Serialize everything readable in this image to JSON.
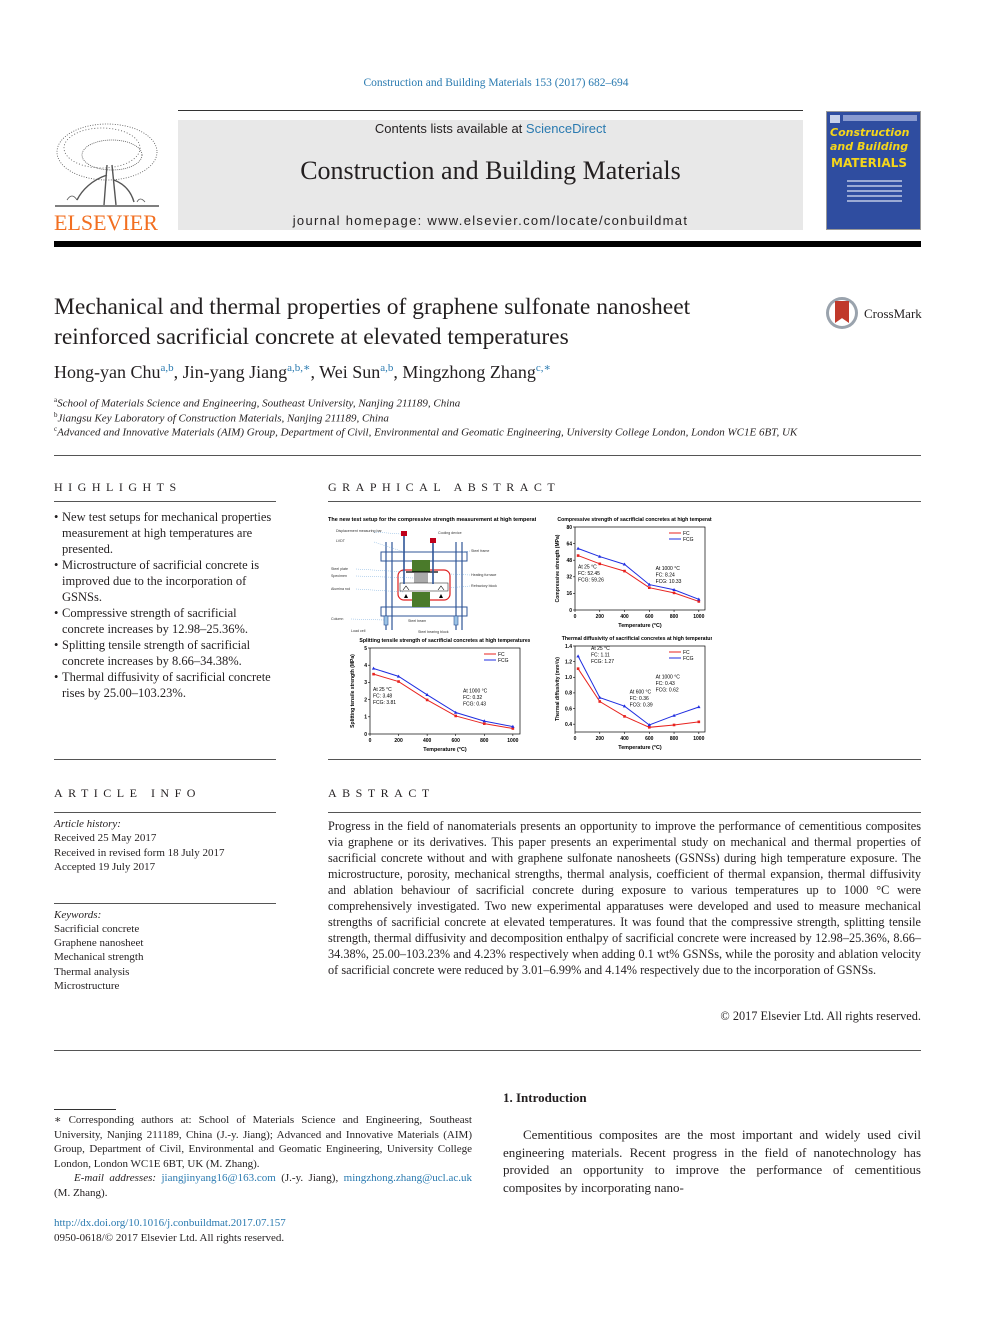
{
  "header": {
    "journal_ref": "Construction and Building Materials 153 (2017) 682–694",
    "contents_prefix": "Contents lists available at ",
    "contents_link": "ScienceDirect",
    "journal_name": "Construction and Building Materials",
    "homepage": "journal homepage: www.elsevier.com/locate/conbuildmat",
    "publisher_logo_text": "ELSEVIER",
    "cover": {
      "line1": "Construction",
      "line2": "and Building",
      "line3": "MATERIALS"
    },
    "crossmark_label": "CrossMark",
    "colors": {
      "link": "#2a7ab0",
      "elsevier_orange": "#f26f21",
      "cover_blue": "#2f4da0",
      "cover_yellow": "#f5d61a"
    }
  },
  "article": {
    "title_line1": "Mechanical and thermal properties of graphene sulfonate nanosheet",
    "title_line2": "reinforced sacrificial concrete at elevated temperatures",
    "authors": [
      {
        "name": "Hong-yan Chu",
        "sup": "a,b",
        "sep": ", "
      },
      {
        "name": "Jin-yang Jiang",
        "sup": "a,b,∗",
        "sep": ", "
      },
      {
        "name": "Wei Sun",
        "sup": "a,b",
        "sep": ", "
      },
      {
        "name": "Mingzhong Zhang",
        "sup": "c,∗",
        "sep": ""
      }
    ],
    "affiliations": [
      {
        "key": "a",
        "text": "School of Materials Science and Engineering, Southeast University, Nanjing 211189, China"
      },
      {
        "key": "b",
        "text": "Jiangsu Key Laboratory of Construction Materials, Nanjing 211189, China"
      },
      {
        "key": "c",
        "text": "Advanced and Innovative Materials (AIM) Group, Department of Civil, Environmental and Geomatic Engineering, University College London, London WC1E 6BT, UK"
      }
    ]
  },
  "highlights": {
    "heading": "HIGHLIGHTS",
    "items": [
      "New test setups for mechanical properties measurement at high temperatures are presented.",
      "Microstructure of sacrificial concrete is improved due to the incorporation of GSNSs.",
      "Compressive strength of sacrificial concrete increases by 12.98–25.36%.",
      "Splitting tensile strength of sacrificial concrete increases by 8.66–34.38%.",
      "Thermal diffusivity of sacrificial concrete rises by 25.00–103.23%."
    ]
  },
  "graphical_abstract": {
    "heading": "GRAPHICAL ABSTRACT",
    "diagram": {
      "title": "The new test setup for the compressive strength measurement at high temperatures",
      "labels_left": [
        "Displacement measuring bar",
        "LVDT",
        "Steel plate",
        "Specimen",
        "Alumina rod",
        "Column",
        "Load cell"
      ],
      "labels_right": [
        "Cooling device",
        "Steel frame",
        "Heating furnace",
        "Refractory block",
        "Steel beam",
        "Steel bearing block"
      ]
    }
  },
  "chart_data": [
    {
      "type": "line",
      "title": "Compressive strength of sacrificial concretes at high temperatures",
      "xlabel": "Temperature (°C)",
      "ylabel": "Compressive strength (MPa)",
      "x": [
        25,
        200,
        400,
        600,
        800,
        1000
      ],
      "xticks": [
        0,
        200,
        400,
        600,
        800,
        1000
      ],
      "yticks": [
        0,
        16,
        32,
        48,
        64,
        80
      ],
      "xlim": [
        0,
        1050
      ],
      "ylim": [
        0,
        80
      ],
      "series": [
        {
          "name": "FC",
          "color": "#e8231f",
          "values": [
            52.45,
            44.5,
            37.5,
            21.5,
            16.5,
            8.24
          ]
        },
        {
          "name": "FCG",
          "color": "#1f2de0",
          "values": [
            59.26,
            51.5,
            44.0,
            24.5,
            19.5,
            10.33
          ]
        }
      ],
      "legend": "top-right",
      "annotations": [
        {
          "lines": [
            "At 25 °C",
            "FC: 52.45",
            "FCG: 59.26"
          ],
          "pos": "left-middle"
        },
        {
          "lines": [
            "At 1000 °C",
            "FC: 8.24",
            "FCG: 10.33"
          ],
          "pos": "right-middle"
        }
      ]
    },
    {
      "type": "line",
      "title": "Splitting tensile strength of sacrificial concretes at high temperatures",
      "xlabel": "Temperature (°C)",
      "ylabel": "Splitting tensile strength (MPa)",
      "x": [
        25,
        200,
        400,
        600,
        800,
        1000
      ],
      "xticks": [
        0,
        200,
        400,
        600,
        800,
        1000
      ],
      "yticks": [
        0,
        1,
        2,
        3,
        4,
        5
      ],
      "xlim": [
        0,
        1050
      ],
      "ylim": [
        0,
        5
      ],
      "series": [
        {
          "name": "FC",
          "color": "#e8231f",
          "values": [
            3.48,
            3.05,
            1.98,
            1.05,
            0.6,
            0.32
          ]
        },
        {
          "name": "FCG",
          "color": "#1f2de0",
          "values": [
            3.81,
            3.35,
            2.28,
            1.25,
            0.75,
            0.43
          ]
        }
      ],
      "legend": "top-right",
      "annotations": [
        {
          "lines": [
            "At 25 °C",
            "FC: 3.48",
            "FCG: 3.81"
          ],
          "pos": "left-middle"
        },
        {
          "lines": [
            "At 1000 °C",
            "FC: 0.32",
            "FCG: 0.43"
          ],
          "pos": "right-middle"
        }
      ]
    },
    {
      "type": "line",
      "title": "Thermal diffusivity of sacrificial concretes at high temperatures",
      "xlabel": "Temperature (°C)",
      "ylabel": "Thermal diffusivity (mm²/s)",
      "x": [
        25,
        200,
        400,
        600,
        800,
        1000
      ],
      "xticks": [
        0,
        200,
        400,
        600,
        800,
        1000
      ],
      "yticks": [
        0.4,
        0.6,
        0.8,
        1.0,
        1.2,
        1.4
      ],
      "xlim": [
        0,
        1050
      ],
      "ylim": [
        0.3,
        1.4
      ],
      "series": [
        {
          "name": "FC",
          "color": "#e8231f",
          "values": [
            1.11,
            0.69,
            0.5,
            0.36,
            0.39,
            0.43
          ]
        },
        {
          "name": "FCG",
          "color": "#1f2de0",
          "values": [
            1.27,
            0.74,
            0.63,
            0.39,
            0.51,
            0.62
          ]
        }
      ],
      "legend": "top-right",
      "annotations": [
        {
          "lines": [
            "At 25 °C",
            "FC: 1.11",
            "FCG: 1.27"
          ],
          "pos": "top-left"
        },
        {
          "lines": [
            "At 600 °C",
            "FC: 0.36",
            "FCG: 0.39"
          ],
          "pos": "center"
        },
        {
          "lines": [
            "At 1000 °C",
            "FC: 0.43",
            "FCG: 0.62"
          ],
          "pos": "right-middle"
        }
      ]
    }
  ],
  "article_info": {
    "heading": "ARTICLE INFO",
    "history_label": "Article history:",
    "history": [
      "Received 25 May 2017",
      "Received in revised form 18 July 2017",
      "Accepted 19 July 2017"
    ],
    "keywords_label": "Keywords:",
    "keywords": [
      "Sacrificial concrete",
      "Graphene nanosheet",
      "Mechanical strength",
      "Thermal analysis",
      "Microstructure"
    ]
  },
  "abstract": {
    "heading": "ABSTRACT",
    "text": "Progress in the field of nanomaterials presents an opportunity to improve the performance of cementitious composites via graphene or its derivatives. This paper presents an experimental study on mechanical and thermal properties of sacrificial concrete without and with graphene sulfonate nanosheets (GSNSs) during high temperature exposure. The microstructure, porosity, mechanical strengths, thermal analysis, coefficient of thermal expansion, thermal diffusivity and ablation behaviour of sacrificial concrete during exposure to various temperatures up to 1000 °C were comprehensively investigated. Two new experimental apparatuses were developed and used to measure mechanical strengths of sacrificial concrete at elevated temperatures. It was found that the compressive strength, splitting tensile strength, thermal diffusivity and decomposition enthalpy of sacrificial concrete were increased by 12.98–25.36%, 8.66–34.38%, 25.00–103.23% and 4.23% respectively when adding 0.1 wt% GSNSs, while the porosity and ablation velocity of sacrificial concrete were reduced by 3.01–6.99% and 4.14% respectively due to the incorporation of GSNSs.",
    "copyright": "© 2017 Elsevier Ltd. All rights reserved."
  },
  "footnotes": {
    "corresponding": "∗ Corresponding authors at: School of Materials Science and Engineering, Southeast University, Nanjing 211189, China (J.-y. Jiang); Advanced and Innovative Materials (AIM) Group, Department of Civil, Environmental and Geomatic Engineering, University College London, London WC1E 6BT, UK (M. Zhang).",
    "email_label": "E-mail addresses: ",
    "email1": "jiangjinyang16@163.com",
    "email1_owner": " (J.-y. Jiang), ",
    "email2": "mingzhong.zhang@ucl.ac.uk",
    "email2_owner": " (M. Zhang).",
    "doi": "http://dx.doi.org/10.1016/j.conbuildmat.2017.07.157",
    "issn": "0950-0618/© 2017 Elsevier Ltd. All rights reserved."
  },
  "introduction": {
    "heading": "1. Introduction",
    "text": "Cementitious composites are the most important and widely used civil engineering materials. Recent progress in the field of nanotechnology has provided an opportunity to improve the performance of cementitious composites by incorporating nano-"
  }
}
